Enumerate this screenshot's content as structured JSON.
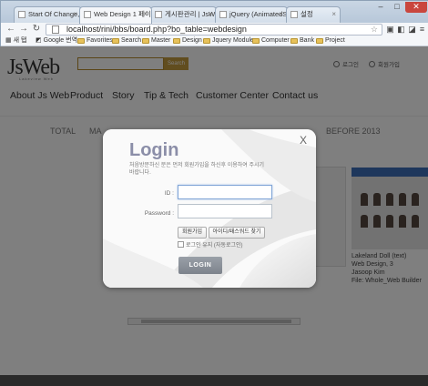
{
  "browser": {
    "tabs": [
      {
        "label": "Start Of Change, Ex"
      },
      {
        "label": "Web Design 1 페이지"
      },
      {
        "label": "게시판관리 | JsWeb"
      },
      {
        "label": "jQuery (AnimatedSc"
      },
      {
        "label": "설정"
      }
    ],
    "window_buttons": {
      "minimize": "–",
      "maximize": "□",
      "close": "✕"
    },
    "address": "localhost/rini/bbs/board.php?bo_table=webdesign",
    "bookmarks": [
      {
        "label": "새 탭"
      },
      {
        "label": "Google 번역"
      },
      {
        "label": "Favorites"
      },
      {
        "label": "Search"
      },
      {
        "label": "Master"
      },
      {
        "label": "Design"
      },
      {
        "label": "Jquery Module"
      },
      {
        "label": "Computer"
      },
      {
        "label": "Bank"
      },
      {
        "label": "Project"
      }
    ]
  },
  "site": {
    "logo": "JsWeb",
    "logo_sub": "Lakeview Web",
    "search_button": "Search",
    "util_login": "로그인",
    "util_join": "회원가입",
    "nav": [
      "About Js Web",
      "Product",
      "Story",
      "Tip & Tech",
      "Customer Center",
      "Contact us"
    ],
    "categories": {
      "total": "TOTAL",
      "ma": "MA",
      "before": "BEFORE 2013"
    },
    "caption": {
      "title": "Lakeland Doll (text)",
      "lines": [
        "Web Design, 3",
        "Jasoop Kim",
        "File: Whole_Web Builder"
      ]
    }
  },
  "modal": {
    "title": "Login",
    "close": "X",
    "description": "처음방문하신 분은 먼저 회원가입을 하신후 이용하여 주시기 바랍니다.",
    "id_label": "ID :",
    "password_label": "Password :",
    "join_button": "회원가입",
    "find_button": "아이디/패스워드 찾기",
    "remember_label": "로그인 유지 (자동로그인)",
    "login_button": "LOGIN"
  }
}
